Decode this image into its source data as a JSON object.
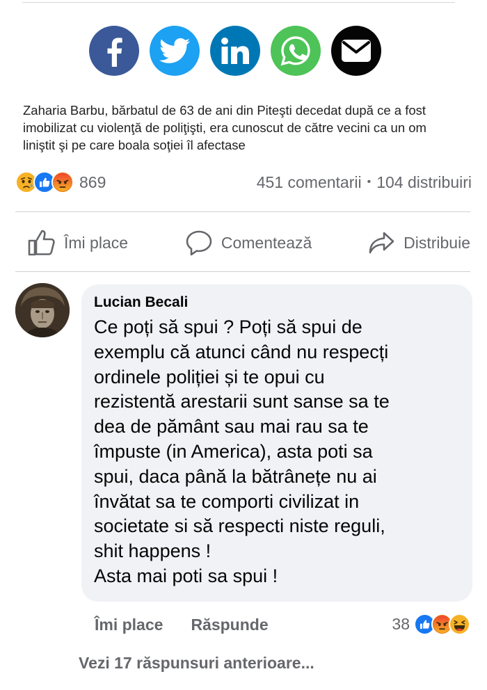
{
  "share": {
    "buttons": [
      {
        "icon": "facebook-icon",
        "color": "#3b5998"
      },
      {
        "icon": "twitter-icon",
        "color": "#1da1f2"
      },
      {
        "icon": "linkedin-icon",
        "color": "#0077b5"
      },
      {
        "icon": "whatsapp-icon",
        "color": "#4ec358"
      },
      {
        "icon": "mail-icon",
        "color": "#050505"
      }
    ]
  },
  "article": {
    "snippet": "Zaharia Barbu, bărbatul de 63 de ani din Piteşti decedat după ce a fost imobilizat cu violenţă de poliţişti, era cunoscut de către vecini ca un om liniştit şi pe care boala soţiei îl afectase"
  },
  "post_stats": {
    "reactions": [
      "sad-reaction-icon",
      "like-reaction-icon",
      "angry-reaction-icon"
    ],
    "reaction_count": "869",
    "comments": "451 comentarii",
    "separator": "•",
    "shares": "104 distribuiri"
  },
  "actions": {
    "like": "Îmi place",
    "comment": "Comentează",
    "share": "Distribuie"
  },
  "comment": {
    "author": "Lucian Becali",
    "text": "Ce poți să spui ? Poți să spui de\nexemplu că atunci când nu respecți\nordinele poliției și te opui cu\nrezistentă arestarii sunt sanse sa te\ndea de pământ sau mai rau sa te\nîmpuste (in America), asta poti sa\nspui, daca până la bătrânețe nu ai\nînvătat sa te comporti civilizat in\nsocietate si să respecti niste reguli,\nshit happens !\nAsta mai poti sa spui !",
    "like_label": "Îmi place",
    "reply_label": "Răspunde",
    "reaction_count": "38",
    "reactions": [
      "like-reaction-icon",
      "angry-reaction-icon",
      "haha-reaction-icon"
    ]
  },
  "replies": {
    "more_label": "Vezi 17 răspunsuri anterioare..."
  },
  "colors": {
    "secondary_text": "#65676b",
    "bubble": "#f0f2f5",
    "like_blue": "#1877f2",
    "angry_red": "#e9710f",
    "reaction_yellow": "#f7b125"
  }
}
